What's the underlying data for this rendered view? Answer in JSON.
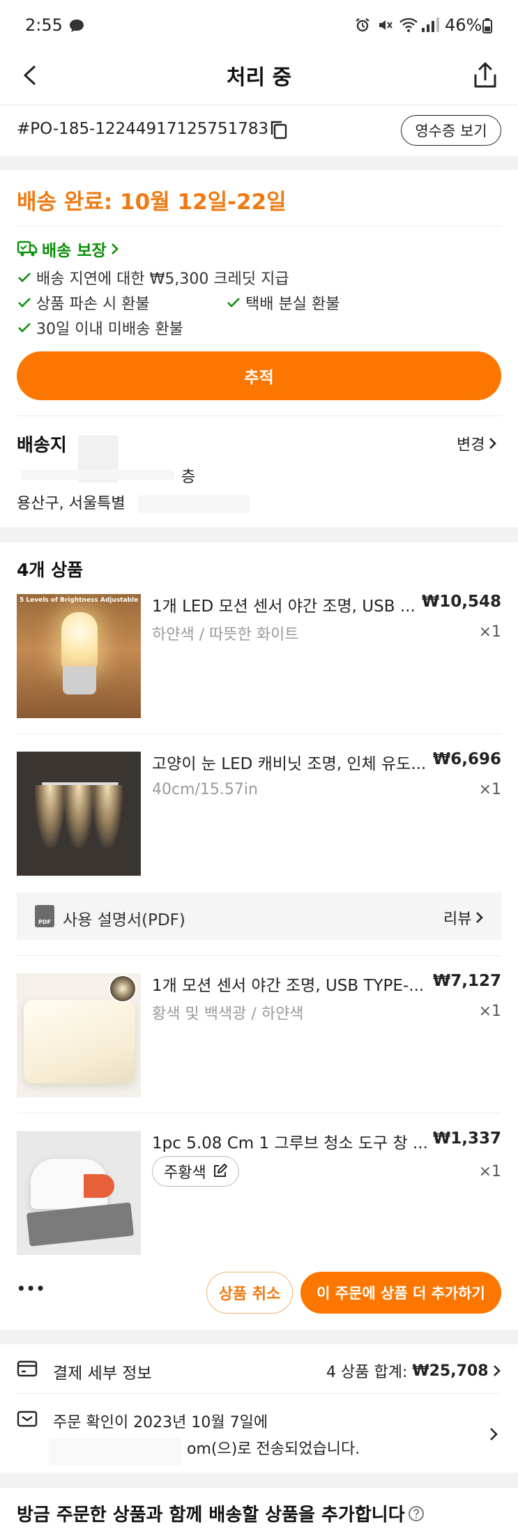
{
  "status_bar": {
    "time": "2:55",
    "battery": "46%"
  },
  "header": {
    "title": "처리 중"
  },
  "order": {
    "id": "#PO-185-12244917125751783",
    "receipt_button": "영수증 보기"
  },
  "delivery": {
    "headline": "배송 완료: 10월 12일-22일",
    "guarantee_title": "배송 보장",
    "guarantees": [
      "배송 지연에 대한 ₩5,300 크레딧 지급",
      "상품 파손 시 환불",
      "택배 분실 환불",
      "30일 이내 미배송 환불"
    ],
    "track_button": "추적"
  },
  "address": {
    "title": "배송지",
    "change_label": "변경",
    "line1": "층",
    "line2": "용산구, 서울특별"
  },
  "items_section": {
    "title": "4개 상품",
    "items": [
      {
        "name": "1개 LED 모션 센서 야간 조명, USB ...",
        "variant": "하얀색 / 따뜻한 화이트",
        "price": "₩10,548",
        "qty": "×1",
        "thumb_text": "5 Levels of Brightness Adjustable"
      },
      {
        "name": "고양이 눈 LED 캐비닛 조명, 인체 유도...",
        "variant": "40cm/15.57in",
        "price": "₩6,696",
        "qty": "×1"
      },
      {
        "name": "1개 모션 센서 야간 조명, USB TYPE-...",
        "variant": "황색 및 백색광 / 하얀색",
        "price": "₩7,127",
        "qty": "×1"
      },
      {
        "name": "1pc 5.08 Cm 1 그루브 청소 도구 창 ...",
        "variant": "주황색",
        "price": "₩1,337",
        "qty": "×1"
      }
    ],
    "manual_label": "사용 설명서(PDF)",
    "manual_icon_text": "PDF",
    "review_label": "리뷰",
    "more_label": "•••",
    "cancel_button": "상품 취소",
    "add_more_button": "이 주문에 상품 더 추가하기"
  },
  "payment": {
    "label": "결제 세부 정보",
    "summary_prefix": "4 상품 합계: ",
    "summary_total": "₩25,708"
  },
  "confirmation": {
    "line1": "주문 확인이 2023년 10월 7일에",
    "line2": "om(으)로 전송되었습니다."
  },
  "add_section": {
    "title": "방금 주문한 상품과 함께 배송할 상품을 추가합니다"
  },
  "colors": {
    "accent": "#fb7701",
    "headline_orange": "#f07a12",
    "success_green": "#0a8f08"
  }
}
